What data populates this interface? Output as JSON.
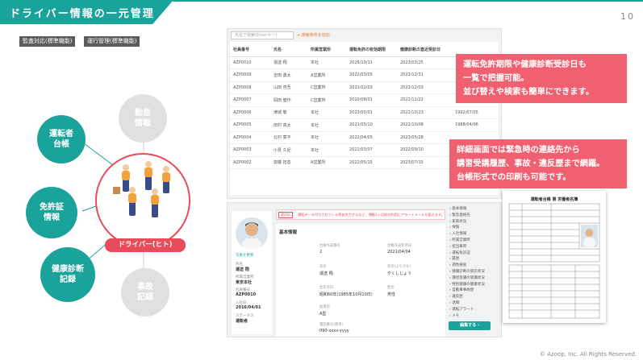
{
  "header": {
    "title": "ドライバー情報の一元管理",
    "page_number": "10"
  },
  "badges": [
    "監査対応(標準機能)",
    "運行管理(標準機能)"
  ],
  "diagram": {
    "center_label": "ドライバー(ヒト)",
    "nodes": [
      {
        "label": "運転者\n台帳",
        "style": "green"
      },
      {
        "label": "免許証\n情報",
        "style": "green"
      },
      {
        "label": "健康診断\n記録",
        "style": "green"
      },
      {
        "label": "勤怠\n情報",
        "style": "gray"
      },
      {
        "label": "事故\n記録",
        "style": "gray"
      }
    ]
  },
  "list_screen": {
    "search_placeholder": "氏名で検索(Enterキー)",
    "advanced_link": "+ 検索条件を追加",
    "columns": [
      "社員番号",
      "氏名",
      "所属営業所",
      "運転免許の有効期限",
      "健康診断の直近受診日",
      "",
      ""
    ],
    "rows": [
      [
        "AZP0010",
        "運送 翔",
        "本社",
        "2026/10/11",
        "2023/03/25",
        "",
        ""
      ],
      [
        "AZP0009",
        "吉田 勇太",
        "A営業所",
        "2022/03/05",
        "2022/12/31",
        "",
        ""
      ],
      [
        "AZP0008",
        "山田 啓吾",
        "C営業所",
        "2021/02/03",
        "2022/12/03",
        "",
        ""
      ],
      [
        "AZP0007",
        "岡田 健作",
        "C営業所",
        "2020/08/01",
        "2022/11/22",
        "",
        ""
      ],
      [
        "AZP0006",
        "津城 敬",
        "本社",
        "2023/05/01",
        "2022/10/23",
        "1992/07/05",
        ""
      ],
      [
        "AZP0005",
        "田村 真太",
        "本社",
        "2021/05/10",
        "2022/10/08",
        "1988/04/06",
        ""
      ],
      [
        "AZP0004",
        "北村 寛平",
        "本社",
        "2022/04/05",
        "2023/05/28",
        "",
        ""
      ],
      [
        "AZP0003",
        "小見 久紀",
        "本社",
        "2021/03/07",
        "2022/09/10",
        "",
        ""
      ],
      [
        "AZP0002",
        "齋藤 拓善",
        "A営業所",
        "2022/05/15",
        "2023/07/15",
        "",
        ""
      ]
    ]
  },
  "tips": [
    [
      "運転免許期限や健康診断受診日も",
      "一覧で把握可能。",
      "並び替えや検索も簡単にできます。"
    ],
    [
      "詳細画面では緊急時の連絡先から",
      "講習受講履歴、事故・違反歴まで網羅。",
      "台帳形式での印刷も可能です。"
    ]
  ],
  "detail_screen": {
    "alert_tag": "要対応",
    "alert_text": "運転データ付与されている等拡大力するなど、運動1ヶ月前の利用にアラートメールが届きます。",
    "photo_caption": "写真を更新",
    "profile": [
      {
        "label": "氏名",
        "value": "運送 翔"
      },
      {
        "label": "所属営業所",
        "value": "東京本社"
      },
      {
        "label": "社員番号",
        "value": "AZP0010"
      },
      {
        "label": "入社日",
        "value": "2016/04/01"
      },
      {
        "label": "ステータス",
        "value": "運転者"
      }
    ],
    "section_title": "基本情報",
    "fields": [
      {
        "label": "台帳作成番号",
        "value": "2"
      },
      {
        "label": "台帳作成年月日",
        "value": "2021/04/04"
      },
      {
        "label": "氏名",
        "value": "運送 翔"
      },
      {
        "label": "氏名(ふりがな)",
        "value": "やくしじょう"
      },
      {
        "label": "生年月日",
        "value": "昭和60年(1985年10月10日)"
      },
      {
        "label": "性別",
        "value": "男性"
      },
      {
        "label": "血液型",
        "value": "A型"
      },
      {
        "label": "電話番号(携帯)",
        "value": "090-xxxx-yyyy"
      }
    ],
    "menu": [
      "基本情報",
      "緊急連絡先",
      "家族状況",
      "保険",
      "入社情報",
      "所属営業所",
      "担当車両",
      "運転免許証",
      "履歴",
      "適性検査",
      "健康診断の受診状況",
      "講習受講の受講状況",
      "特別健康の健康状況",
      "自動車事故歴",
      "違反歴",
      "退職",
      "運転アラート",
      "メモ"
    ],
    "edit_button": "編集する ›"
  },
  "ledger": {
    "title": "運転者台帳 第 労働者名簿"
  },
  "copyright": "© Azoop, Inc. All Rights Reserved."
}
